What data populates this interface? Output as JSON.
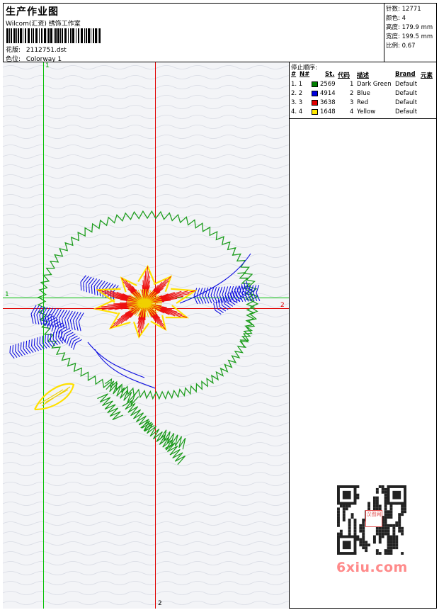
{
  "header": {
    "title": "生产作业图",
    "company": "Wilcom(汇资) 绣饰工作室",
    "design_label": "花版:",
    "design_value": "2112751.dst",
    "colorway_label": "色位:",
    "colorway_value": "Colorway 1"
  },
  "stats": {
    "stitches_label": "针数:",
    "stitches_value": "12771",
    "colors_label": "颜色:",
    "colors_value": "4",
    "height_label": "高度:",
    "height_value": "179.9 mm",
    "width_label": "宽度:",
    "width_value": "199.5 mm",
    "scale_label": "比例:",
    "scale_value": "0.67"
  },
  "guides": {
    "green_top": "1",
    "green_left": "1",
    "red_right": "2",
    "red_bottom": "2"
  },
  "stop_sequence": {
    "title": "停止顺序:",
    "headers": {
      "hash": "#",
      "n": "N#",
      "st": "St.",
      "code": "代码",
      "desc": "描述",
      "brand": "Brand",
      "element": "元素"
    },
    "rows": [
      {
        "idx": "1. 1",
        "stitches": "2569",
        "code": "1",
        "description": "Dark Green",
        "brand": "Default",
        "color": "#008000"
      },
      {
        "idx": "2. 2",
        "stitches": "4914",
        "code": "2",
        "description": "Blue",
        "brand": "Default",
        "color": "#0000e0"
      },
      {
        "idx": "3. 3",
        "stitches": "3638",
        "code": "3",
        "description": "Red",
        "brand": "Default",
        "color": "#e00000"
      },
      {
        "idx": "4. 4",
        "stitches": "1648",
        "code": "4",
        "description": "Yellow",
        "brand": "Default",
        "color": "#ffe800"
      }
    ]
  },
  "watermark": "6xiu.com",
  "qr_stamp": "汉图网"
}
